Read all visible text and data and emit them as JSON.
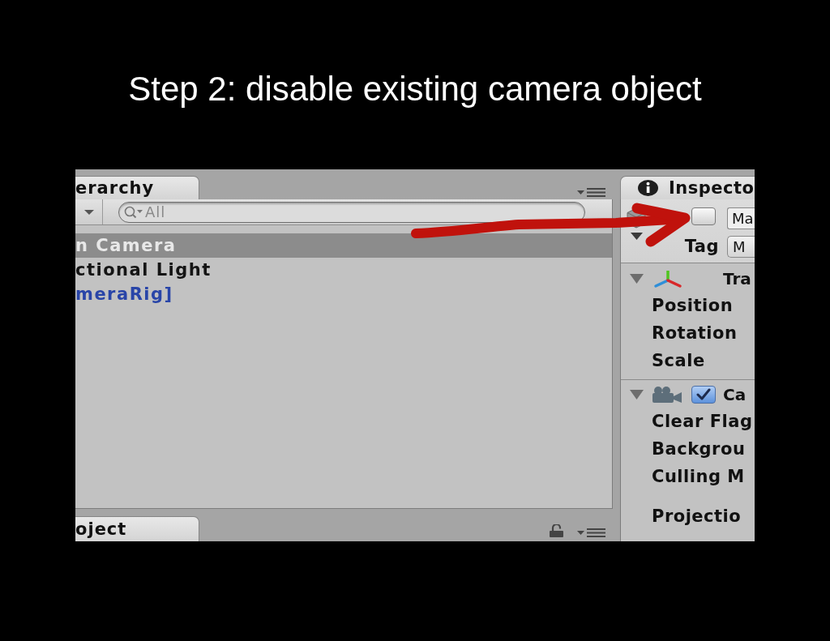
{
  "slide": {
    "title": "Step 2: disable existing camera object"
  },
  "hierarchy": {
    "tab": {
      "label": "erarchy",
      "selected": true
    },
    "search": {
      "placeholder": "All"
    },
    "items": [
      {
        "label": "n Camera",
        "kind": "object",
        "selected": true
      },
      {
        "label": "ctional Light",
        "kind": "object",
        "selected": false
      },
      {
        "label": "meraRig]",
        "kind": "prefab",
        "selected": false
      }
    ]
  },
  "project": {
    "tab": {
      "label": "oject",
      "selected": true
    },
    "locked": false
  },
  "inspector": {
    "tab": {
      "label": "Inspecto",
      "selected": true
    },
    "header": {
      "active": false,
      "name": "Ma",
      "tag_label": "Tag",
      "tag": "M"
    },
    "components": [
      {
        "kind": "transform",
        "title": "Tra",
        "expanded": true,
        "property_groups": [
          [
            "Position",
            "Rotation",
            "Scale"
          ]
        ]
      },
      {
        "kind": "camera",
        "title": "Ca",
        "expanded": true,
        "enabled": true,
        "property_groups": [
          [
            "Clear Flag",
            "Backgrou",
            "Culling M"
          ],
          [
            "Projectio"
          ]
        ]
      }
    ]
  },
  "annotation": {
    "kind": "arrow"
  }
}
